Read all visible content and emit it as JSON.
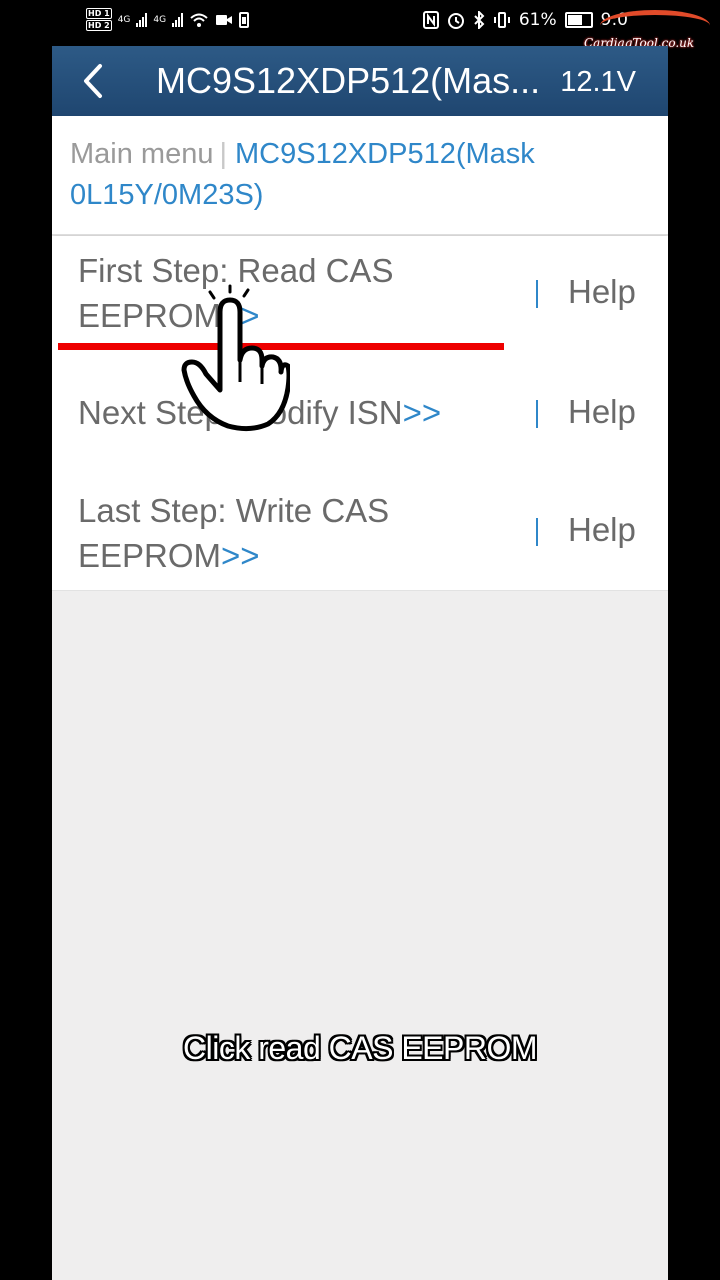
{
  "status_bar": {
    "hd_badges": [
      "HD 1",
      "HD 2"
    ],
    "signal_1": "4G",
    "signal_2": "4G",
    "battery_percent": "61%",
    "time": "9:0"
  },
  "watermark": {
    "text": "CardiagTool.co.uk",
    "accent": "#e14b2a"
  },
  "header": {
    "back_icon": "chevron-left-icon",
    "title": "MC9S12XDP512(Mas...",
    "voltage": "12.1V",
    "background": "#23507d"
  },
  "breadcrumb": {
    "main": "Main menu",
    "separator": "|",
    "current": "MC9S12XDP512(Mask 0L15Y/0M23S)"
  },
  "steps": [
    {
      "label": "First Step: Read CAS EEPROM",
      "arrows": ">>",
      "help": "Help"
    },
    {
      "label": "Next Step: Modify ISN",
      "arrows": ">>",
      "help": "Help"
    },
    {
      "label": "Last Step: Write CAS EEPROM",
      "arrows": ">>",
      "help": "Help"
    }
  ],
  "overlay": {
    "pointer_icon": "hand-pointer-icon",
    "highlight_color": "#ee0000",
    "caption": "Click read CAS EEPROM"
  },
  "colors": {
    "accent": "#2f87c9",
    "body_bg": "#efeeee"
  }
}
